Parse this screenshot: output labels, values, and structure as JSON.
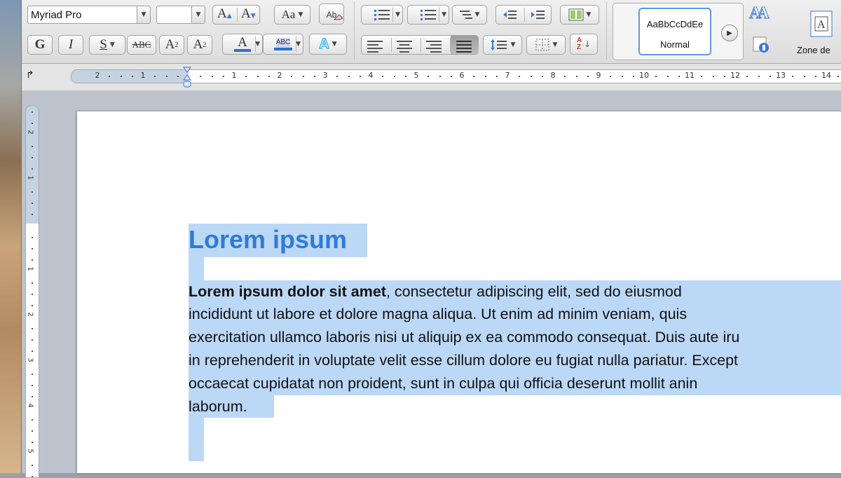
{
  "ribbon": {
    "font_name": "Myriad Pro",
    "font_size": "",
    "grow_font_label": "A",
    "shrink_font_label": "A",
    "change_case_label": "Aa",
    "clear_format_label": "Ab",
    "bold_label": "G",
    "italic_label": "I",
    "underline_label": "S",
    "strikethrough_label": "ABC",
    "superscript_label": "A",
    "superscript_sup": "2",
    "subscript_label": "A",
    "subscript_sub": "2",
    "font_color_label": "A",
    "highlight_label": "ABC",
    "text_effects_label": "A",
    "sort_label": "AZ",
    "styles_label": "AA",
    "style_preview": "AaBbCcDdEe",
    "style_name": "Normal",
    "textbox_label": "Zone de",
    "colors": {
      "font_color": "#2f6fd0",
      "highlight": "#2f6fd0",
      "text_effects": "#47b9e8",
      "accent": "#5b9be4"
    }
  },
  "ruler": {
    "tab_selector": "↱",
    "horizontal_numbers": [
      "2",
      "1",
      "1",
      "2",
      "3",
      "4",
      "5",
      "6",
      "7",
      "8",
      "9",
      "10",
      "11",
      "12",
      "13",
      "14"
    ],
    "vertical_numbers": [
      "2",
      "1",
      "1",
      "2",
      "3",
      "4",
      "5"
    ]
  },
  "document": {
    "title": "Lorem ipsum",
    "paragraph_bold": "Lorem ipsum dolor sit amet",
    "paragraph_lines": [
      ", consectetur adipiscing elit, sed do eiusmod",
      "incididunt ut labore et dolore magna aliqua. Ut enim ad minim veniam, quis",
      "exercitation ullamco laboris nisi ut aliquip ex ea commodo consequat. Duis aute iru",
      "in reprehenderit in voluptate velit esse cillum dolore eu fugiat nulla pariatur. Except",
      "occaecat cupidatat non proident, sunt in culpa qui officia deserunt mollit anin",
      "laborum."
    ],
    "selection_color": "#bcd8f7",
    "title_color": "#2f7bd6"
  }
}
